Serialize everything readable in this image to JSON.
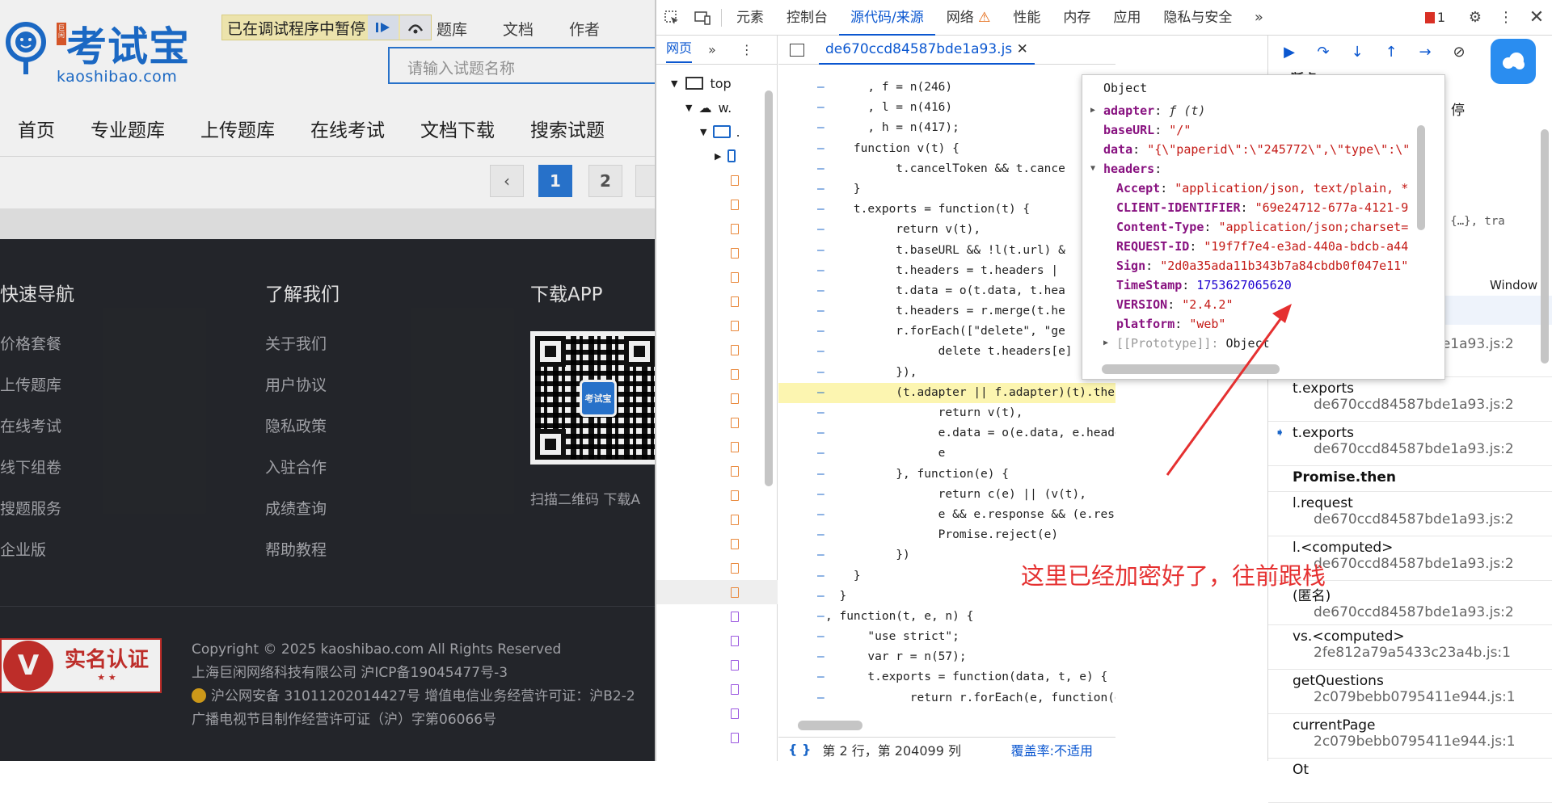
{
  "site": {
    "brand": "考试宝",
    "domain": "kaoshibao.com",
    "logo_tag": "巨闲",
    "debug_banner": "已在调试程序中暂停",
    "top_links": [
      "题库",
      "文档",
      "作者"
    ],
    "search_placeholder": "请输入试题名称",
    "nav": [
      "首页",
      "专业题库",
      "上传题库",
      "在线考试",
      "文档下载",
      "搜索试题"
    ],
    "pager": {
      "prev": "‹",
      "pages": [
        "1",
        "2"
      ],
      "current": "1"
    },
    "footer": {
      "col1": {
        "title": "快速导航",
        "items": [
          "价格套餐",
          "上传题库",
          "在线考试",
          "线下组卷",
          "搜题服务",
          "企业版"
        ]
      },
      "col2": {
        "title": "了解我们",
        "items": [
          "关于我们",
          "用户协议",
          "隐私政策",
          "入驻合作",
          "成绩查询",
          "帮助教程"
        ]
      },
      "col3": {
        "title": "下载APP",
        "qr_center": "考试宝",
        "scan": "扫描二维码 下载A"
      },
      "badge": {
        "v": "V",
        "text": "实名认证",
        "stars": "★ ★"
      },
      "copyright": [
        "Copyright © 2025 kaoshibao.com All Rights Reserved",
        "上海巨闲网络科技有限公司 沪ICP备19045477号-3",
        "沪公网安备 31011202014427号 增值电信业务经营许可证：沪B2-2",
        "广播电视节目制作经营许可证（沪）字第06066号"
      ]
    }
  },
  "devtools": {
    "tabs": [
      "元素",
      "控制台",
      "源代码/来源",
      "网络",
      "性能",
      "内存",
      "应用",
      "隐私与安全"
    ],
    "active_tab": "源代码/来源",
    "network_warning": "⚠",
    "issues_count": "1",
    "sidebar": {
      "tab": "网页",
      "tree": [
        {
          "label": "top"
        },
        {
          "label": "w."
        },
        {
          "label": "."
        },
        {
          "label": ""
        }
      ]
    },
    "file_tab": "de670ccd84587bde1a93.js",
    "status": {
      "position": "第 2 行，第 204099 列",
      "coverage_label": "覆盖率:",
      "coverage_value": "不适用"
    },
    "code_lines": [
      ", f = n(246)",
      ", l = n(416)",
      ", h = n(417);",
      "function v(t) {",
      "    t.cancelToken && t.cance",
      "}",
      "t.exports = function(t) {",
      "    return v(t),",
      "    t.baseURL && !l(t.url) &",
      "    t.headers = t.headers |",
      "    t.data = o(t.data, t.hea",
      "    t.headers = r.merge(t.he",
      "    r.forEach([\"delete\", \"ge",
      "        delete t.headers[e]",
      "    }),",
      "    (t.adapter || f.adapter)(t).then(function(e) {",
      "        return v(t),",
      "        e.data = o(e.data, e.headers, t.transformRe",
      "        e",
      "    }, function(e) {",
      "        return c(e) || (v(t),",
      "        e && e.response && (e.response.data = o(e.r",
      "        Promise.reject(e)",
      "    })",
      "}",
      "}",
      ", function(t, e, n) {",
      "    \"use strict\";",
      "    var r = n(57);",
      "    t.exports = function(data, t, e) {",
      "        return r.forEach(e, function(e) {"
    ],
    "popup": {
      "title": "Object",
      "rows": [
        {
          "k": "adapter",
          "v": "ƒ (t)",
          "type": "fn",
          "exp": "▶"
        },
        {
          "k": "baseURL",
          "v": "\"/\"",
          "type": "s"
        },
        {
          "k": "data",
          "v": "\"{\\\"paperid\\\":\\\"245772\\\",\\\"type\\\":\\\"",
          "type": "s"
        },
        {
          "k": "headers",
          "v": "",
          "type": "h",
          "exp": "▼"
        },
        {
          "k": "Accept",
          "v": "\"application/json, text/plain, *",
          "type": "s",
          "indent": true
        },
        {
          "k": "CLIENT-IDENTIFIER",
          "v": "\"69e24712-677a-4121-9",
          "type": "s",
          "indent": true
        },
        {
          "k": "Content-Type",
          "v": "\"application/json;charset=",
          "type": "s",
          "indent": true
        },
        {
          "k": "REQUEST-ID",
          "v": "\"19f7f7e4-e3ad-440a-bdcb-a44",
          "type": "s",
          "indent": true
        },
        {
          "k": "Sign",
          "v": "\"2d0a35ada11b343b7a84cbdb0f047e11\"",
          "type": "s",
          "indent": true
        },
        {
          "k": "TimeStamp",
          "v": "1753627065620",
          "type": "n",
          "indent": true
        },
        {
          "k": "VERSION",
          "v": "\"2.4.2\"",
          "type": "s",
          "indent": true
        },
        {
          "k": "platform",
          "v": "\"web\"",
          "type": "s",
          "indent": true
        },
        {
          "k": "[[Prototype]]",
          "v": "Object",
          "type": "p",
          "indent": true,
          "exp": "▶"
        }
      ]
    },
    "right": {
      "paused_header": "断点",
      "paused_text": "停",
      "scope_snippet": "t: {…}, tra",
      "window_label": "Window",
      "frames": [
        {
          "name": "",
          "loc": "de670ccd84587bde1a93.js:2"
        },
        {
          "name": "t.exports",
          "loc": "de670ccd84587bde1a93.js:2"
        },
        {
          "name": "t.exports",
          "loc": "de670ccd84587bde1a93.js:2",
          "current": true
        },
        {
          "name": "Promise.then",
          "loc": "",
          "async": true
        },
        {
          "name": "l.request",
          "loc": "de670ccd84587bde1a93.js:2"
        },
        {
          "name": "l.<computed>",
          "loc": "de670ccd84587bde1a93.js:2"
        },
        {
          "name": "(匿名)",
          "loc": "de670ccd84587bde1a93.js:2"
        },
        {
          "name": "vs.<computed>",
          "loc": "2fe812a79a5433c23a4b.js:1"
        },
        {
          "name": "getQuestions",
          "loc": "2c079bebb0795411e944.js:1"
        },
        {
          "name": "currentPage",
          "loc": "2c079bebb0795411e944.js:1"
        },
        {
          "name": "Ot",
          "loc": ""
        }
      ]
    },
    "annotation": "这里已经加密好了，往前跟栈"
  }
}
